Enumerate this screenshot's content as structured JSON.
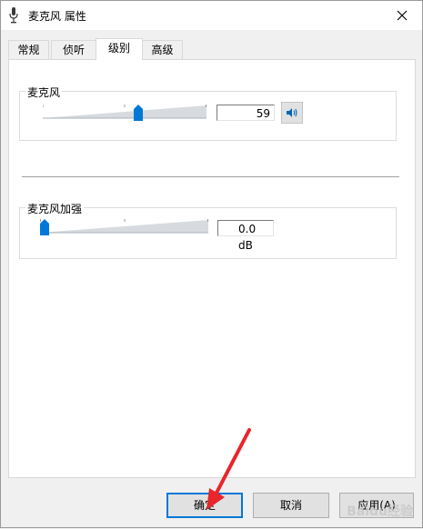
{
  "window": {
    "title": "麦克风 属性",
    "close_icon": "close-icon"
  },
  "tabs": [
    {
      "label": "常规",
      "active": false
    },
    {
      "label": "侦听",
      "active": false
    },
    {
      "label": "级别",
      "active": true
    },
    {
      "label": "高级",
      "active": false
    }
  ],
  "microphone": {
    "group_title": "麦克风",
    "level": 59,
    "level_fraction": 0.59,
    "value_text": "59",
    "mute_icon": "speaker-icon"
  },
  "boost": {
    "group_title": "麦克风加强",
    "level_fraction": 0.0,
    "value_text": "0.0 dB"
  },
  "buttons": {
    "ok": "确定",
    "cancel": "取消",
    "apply": "应用(A)"
  },
  "watermark": "Baidu经验",
  "colors": {
    "accent": "#0078d7",
    "annotation_arrow": "#e8262b"
  }
}
